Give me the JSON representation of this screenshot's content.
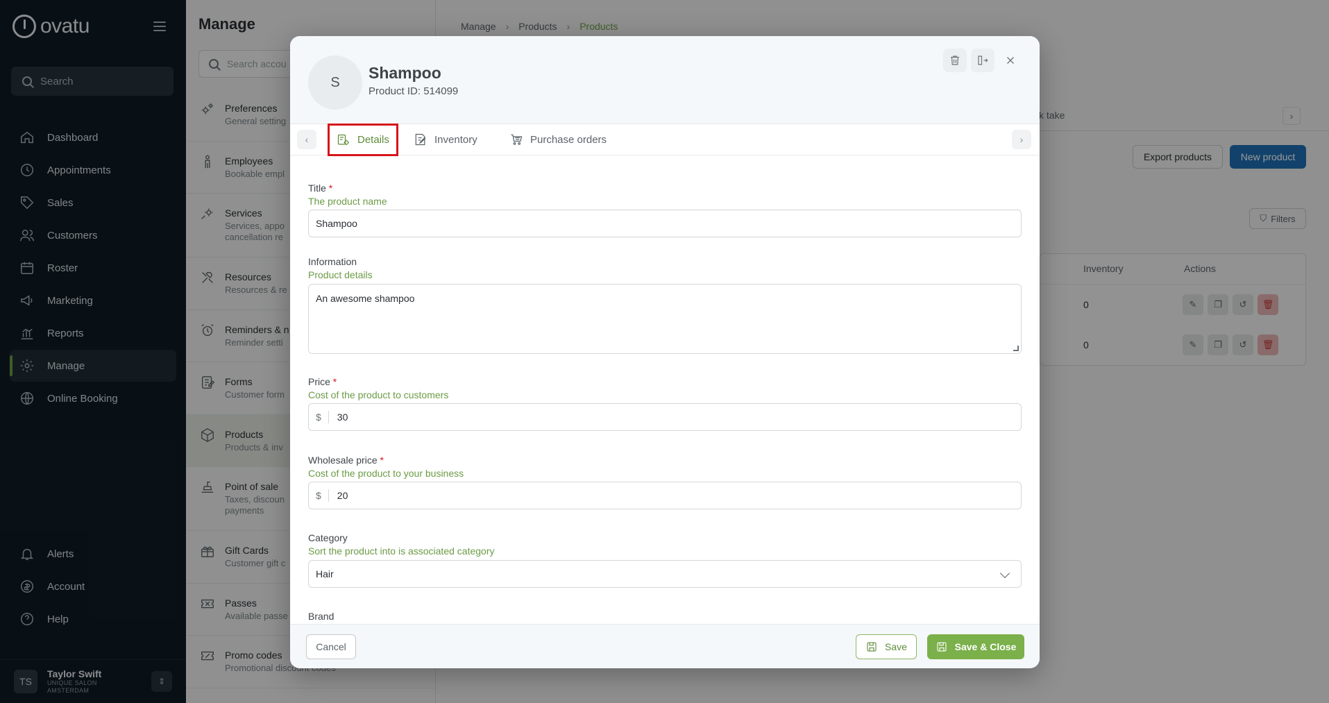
{
  "app": {
    "brand": "ovatu"
  },
  "sidebar": {
    "search_label": "Search",
    "items": [
      {
        "label": "Dashboard",
        "icon": "home-icon"
      },
      {
        "label": "Appointments",
        "icon": "clock-icon"
      },
      {
        "label": "Sales",
        "icon": "tag-icon"
      },
      {
        "label": "Customers",
        "icon": "users-icon"
      },
      {
        "label": "Roster",
        "icon": "calendar-icon"
      },
      {
        "label": "Marketing",
        "icon": "megaphone-icon"
      },
      {
        "label": "Reports",
        "icon": "chart-icon"
      },
      {
        "label": "Manage",
        "icon": "gear-icon",
        "active": true
      },
      {
        "label": "Online Booking",
        "icon": "globe-icon"
      }
    ],
    "bottom_items": [
      {
        "label": "Alerts",
        "icon": "bell-icon"
      },
      {
        "label": "Account",
        "icon": "account-icon"
      },
      {
        "label": "Help",
        "icon": "help-icon"
      }
    ],
    "user": {
      "initials": "TS",
      "name": "Taylor Swift",
      "org": "UNIQUE SALON AMSTERDAM"
    }
  },
  "manage": {
    "title": "Manage",
    "search_placeholder": "Search accou",
    "items": [
      {
        "title": "Preferences",
        "sub": "General setting"
      },
      {
        "title": "Employees",
        "sub": "Bookable empl"
      },
      {
        "title": "Services",
        "sub": "Services, appo cancellation re"
      },
      {
        "title": "Resources",
        "sub": "Resources & re"
      },
      {
        "title": "Reminders & n",
        "sub": "Reminder setti"
      },
      {
        "title": "Forms",
        "sub": "Customer form"
      },
      {
        "title": "Products",
        "sub": "Products & inv",
        "active": true
      },
      {
        "title": "Point of sale",
        "sub": "Taxes, discoun payments"
      },
      {
        "title": "Gift Cards",
        "sub": "Customer gift c"
      },
      {
        "title": "Passes",
        "sub": "Available passe"
      },
      {
        "title": "Promo codes",
        "sub": "Promotional discount codes"
      }
    ]
  },
  "products_page": {
    "breadcrumb": [
      "Manage",
      "Products",
      "Products"
    ],
    "tab_partial": "ck take",
    "export_label": "Export products",
    "new_label": "New product",
    "filters_label": "Filters",
    "columns": [
      "Inventory",
      "Actions"
    ],
    "rows": [
      {
        "inventory": "0"
      },
      {
        "inventory": "0"
      }
    ]
  },
  "modal": {
    "avatar_initial": "S",
    "title": "Shampoo",
    "product_id": "Product ID: 514099",
    "tabs": [
      "Details",
      "Inventory",
      "Purchase orders"
    ],
    "fields": {
      "title": {
        "label": "Title",
        "help": "The product name",
        "value": "Shampoo"
      },
      "information": {
        "label": "Information",
        "help": "Product details",
        "value": "An awesome shampoo"
      },
      "price": {
        "label": "Price",
        "help": "Cost of the product to customers",
        "prefix": "$",
        "value": "30"
      },
      "wholesale": {
        "label": "Wholesale price",
        "help": "Cost of the product to your business",
        "prefix": "$",
        "value": "20"
      },
      "category": {
        "label": "Category",
        "help": "Sort the product into is associated category",
        "value": "Hair"
      },
      "brand": {
        "label": "Brand"
      }
    },
    "required_mark": "*",
    "footer": {
      "cancel": "Cancel",
      "save": "Save",
      "save_close": "Save & Close"
    }
  },
  "colors": {
    "accent_green": "#6b9b45",
    "primary_blue": "#1f6fb3",
    "highlight_red": "#d6141b",
    "sidebar_bg": "#0f1c24"
  }
}
